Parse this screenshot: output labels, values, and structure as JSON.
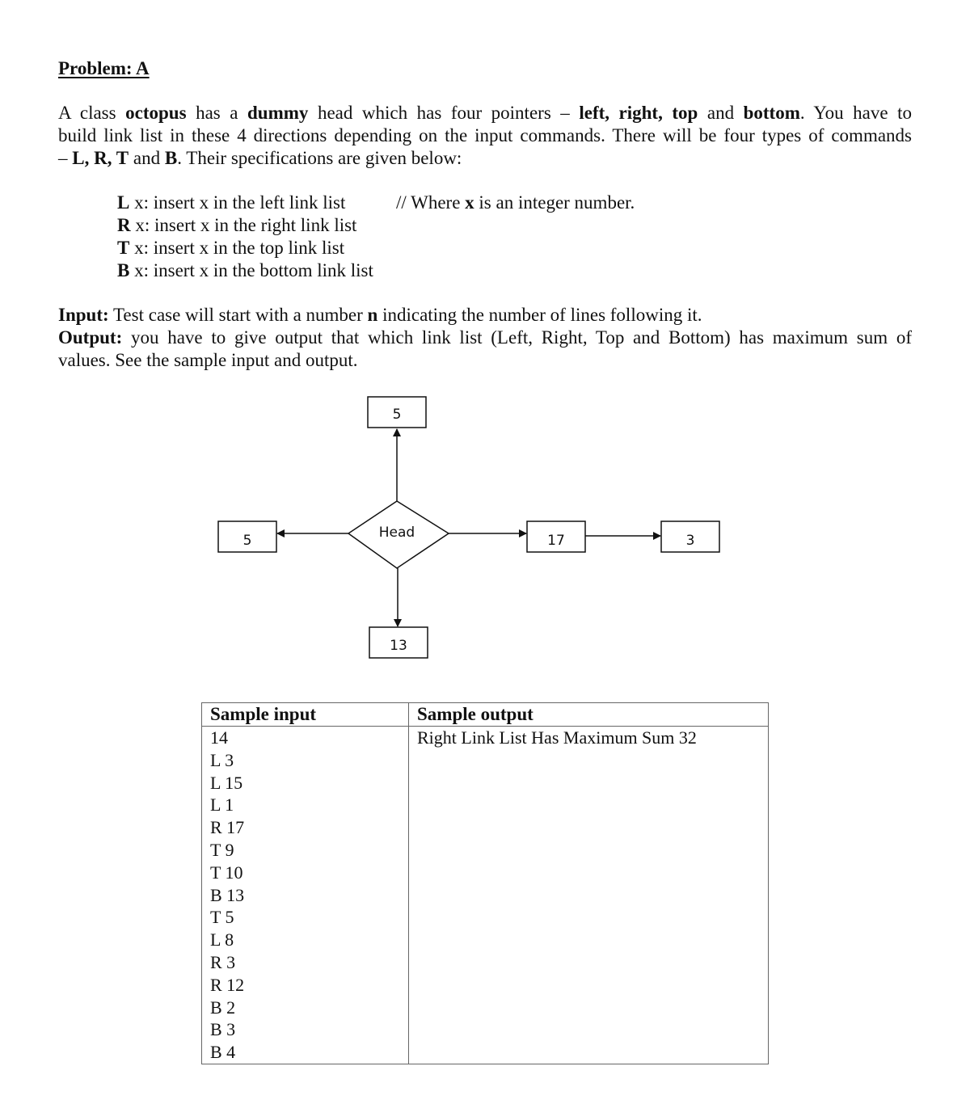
{
  "title": "Problem: A",
  "intro": {
    "line1": [
      "A class ",
      "octopus",
      " has a ",
      "dummy",
      " head which has four pointers – ",
      "left, right, top",
      " and ",
      "bottom",
      ". You have to"
    ],
    "line2": "build link list in these 4 directions depending on the input commands. There will be four types of commands",
    "line3": [
      "– ",
      "L, R, T",
      " and ",
      "B",
      ". Their specifications are given below:"
    ]
  },
  "specs": [
    {
      "cmd": "L",
      "desc": " x: insert x in the left link list"
    },
    {
      "cmd": "R",
      "desc": " x: insert x in the right link list"
    },
    {
      "cmd": "T",
      "desc": " x: insert x in the top link list"
    },
    {
      "cmd": "B",
      "desc": " x: insert x in the bottom link list"
    }
  ],
  "spec_note": [
    "// Where ",
    "x",
    " is an integer number."
  ],
  "io": {
    "input_label": "Input:",
    "input_text_a": " Test case will start with a number ",
    "input_var": "n",
    "input_text_b": " indicating the number of lines following it.",
    "output_label": "Output:",
    "output_text_1": " you have to give output that which link list (Left, Right, Top and Bottom) has maximum sum of",
    "output_text_2": "values. See the sample input and output."
  },
  "diagram": {
    "head_label": "Head",
    "top_nodes": [
      "5"
    ],
    "left_nodes": [
      "5"
    ],
    "right_nodes": [
      "17",
      "3"
    ],
    "bottom_nodes": [
      "13"
    ]
  },
  "samples": {
    "input_header": "Sample input",
    "output_header": "Sample output",
    "input_lines": [
      "14",
      "L 3",
      "L 15",
      "L 1",
      "R 17",
      "T 9",
      "T 10",
      "B 13",
      "T 5",
      "L 8",
      "R 3",
      "R 12",
      "B 2",
      "B 3",
      "B 4"
    ],
    "output_lines": [
      "Right Link List Has Maximum Sum 32"
    ]
  }
}
